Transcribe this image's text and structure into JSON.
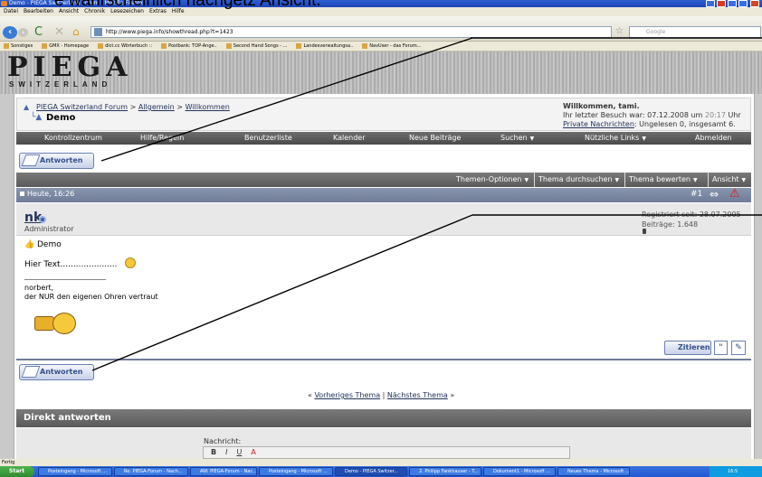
{
  "overlay_caption": "e wahrscheinlich nachgetz Ansicht.",
  "window": {
    "title": "Demo - PIEGA Switzerland Forum - Mozilla Firefox"
  },
  "menu": [
    "Datei",
    "Bearbeiten",
    "Ansicht",
    "Chronik",
    "Lesezeichen",
    "Extras",
    "Hilfe"
  ],
  "browser": {
    "url": "http://www.piega.info/showthread.php?t=1423",
    "search_placeholder": "Google"
  },
  "bookmarks": [
    "Sonstiges",
    "GMX - Homepage",
    "dict.cc Wörterbuch ::",
    "Postbank: TOP-Ange..",
    "Second Hand Songs - ...",
    "Landesverwaltungsa..",
    "NavUser - das Forum..."
  ],
  "logo": {
    "title": "PIEGA",
    "subtitle": "SWITZERLAND"
  },
  "breadcrumb": {
    "forum": "PIEGA Switzerland Forum",
    "sep1": " > ",
    "section": "Allgemein",
    "sep2": " > ",
    "subsection": "Willkommen",
    "thread": "Demo"
  },
  "welcome": {
    "greeting": "Willkommen, tami.",
    "last_visit_label": "Ihr letzter Besuch war: 07.12.2008 um ",
    "last_visit_time": "20:17",
    "last_visit_suffix": " Uhr",
    "pm_link": "Private Nachrichten",
    "pm_status": ": Ungelesen 0, insgesamt 6."
  },
  "mainnav": {
    "items": [
      "Kontrollzentrum",
      "Hilfe/Regeln",
      "Benutzerliste",
      "Kalender",
      "Neue Beiträge",
      "Suchen",
      "Nützliche Links",
      "Abmelden"
    ]
  },
  "reply_button": "Antworten",
  "thread_tools": [
    "Themen-Optionen",
    "Thema durchsuchen",
    "Thema bewerten",
    "Ansicht"
  ],
  "post": {
    "date": "Heute, 16:26",
    "number": "#1",
    "username": "nk",
    "usertitle": "Administrator",
    "registered": "Registriert seit: 28.07.2005",
    "posts": "Beiträge: 1.648",
    "title": "Demo",
    "body": "Hier Text......................",
    "signature": [
      "norbert,",
      "der NUR den eigenen Ohren vertraut"
    ],
    "quote_button": "Zitieren"
  },
  "thread_nav": {
    "prev_prefix": "« ",
    "prev": "Vorheriges Thema",
    "sep": " | ",
    "next": "Nächstes Thema",
    "next_suffix": " »"
  },
  "quick_reply": {
    "title": "Direkt antworten",
    "message_label": "Nachricht:",
    "toolbar": [
      "B",
      "I",
      "U",
      "A"
    ]
  },
  "status": "Fertig",
  "taskbar": {
    "start": "Start",
    "tasks": [
      "Posteingang - Microsoft ...",
      "Re: PIEGA-Forum - Nach...",
      "AW: PIEGA-Forum - Nac...",
      "Posteingang - Microsoft ...",
      "Demo - PIEGA Switzer...",
      "2. Philipp Fankhauser - T...",
      "Dokument1 - Microsoft ...",
      "Neues Thema - Microsoft ..."
    ],
    "clock": "16:5"
  }
}
